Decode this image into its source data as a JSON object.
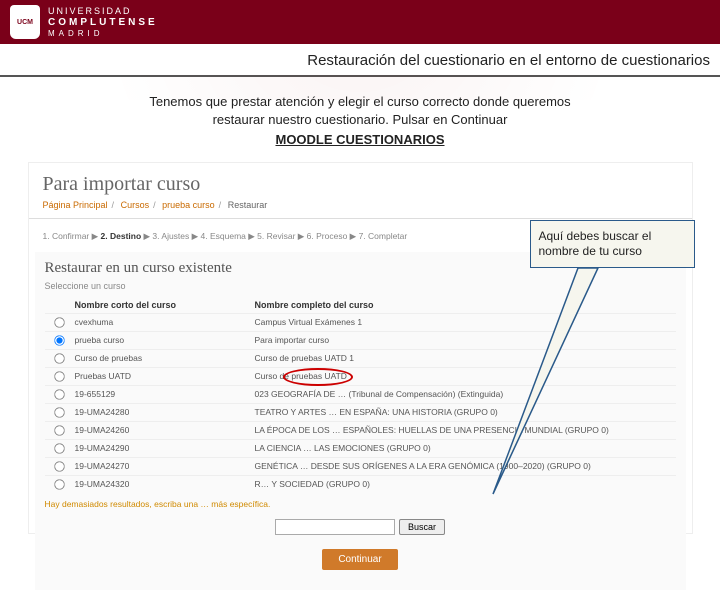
{
  "header": {
    "uni": "UNIVERSIDAD",
    "comp": "COMPLUTENSE",
    "mad": "MADRID"
  },
  "title": "Restauración del cuestionario en el entorno de cuestionarios",
  "intro": {
    "line1": "Tenemos que prestar atención y elegir el curso correcto donde queremos",
    "line2": "restaurar nuestro cuestionario. Pulsar en Continuar",
    "link": "MOODLE CUESTIONARIOS"
  },
  "callout": "Aquí debes buscar el nombre de tu curso",
  "moodle": {
    "page_title": "Para importar curso",
    "breadcrumb": [
      "Página Principal",
      "Cursos",
      "prueba curso",
      "Restaurar"
    ],
    "steps": "1. Confirmar ▶ 2. Destino ▶ 3. Ajustes ▶ 4. Esquema ▶ 5. Revisar ▶ 6. Proceso ▶ 7. Completar",
    "section_title": "Restaurar en un curso existente",
    "section_sub": "Seleccione un curso",
    "thead": {
      "short": "Nombre corto del curso",
      "full": "Nombre completo del curso"
    },
    "rows": [
      {
        "short": "cvexhuma",
        "full": "Campus Virtual Exámenes 1",
        "checked": false
      },
      {
        "short": "prueba curso",
        "full": "Para importar curso",
        "checked": true
      },
      {
        "short": "Curso de pruebas",
        "full": "Curso de pruebas UATD 1",
        "checked": false
      },
      {
        "short": "Pruebas UATD",
        "full": "Curso de pruebas UATD",
        "checked": false
      },
      {
        "short": "19-655129",
        "full": "023 GEOGRAFÍA DE … (Tribunal de Compensación) (Extinguida)",
        "checked": false
      },
      {
        "short": "19-UMA24280",
        "full": "TEATRO Y ARTES … EN ESPAÑA: UNA HISTORIA (GRUPO 0)",
        "checked": false
      },
      {
        "short": "19-UMA24260",
        "full": "LA ÉPOCA DE LOS … ESPAÑOLES: HUELLAS DE UNA PRESENCIA MUNDIAL (GRUPO 0)",
        "checked": false
      },
      {
        "short": "19-UMA24290",
        "full": "LA CIENCIA … LAS EMOCIONES (GRUPO 0)",
        "checked": false
      },
      {
        "short": "19-UMA24270",
        "full": "GENÉTICA … DESDE SUS ORÍGENES A LA ERA GENÓMICA (1900–2020) (GRUPO 0)",
        "checked": false
      },
      {
        "short": "19-UMA24320",
        "full": "R… Y SOCIEDAD (GRUPO 0)",
        "checked": false
      }
    ],
    "warn": "Hay demasiados resultados, escriba una … más específica.",
    "search_btn": "Buscar",
    "continue_btn": "Continuar"
  }
}
